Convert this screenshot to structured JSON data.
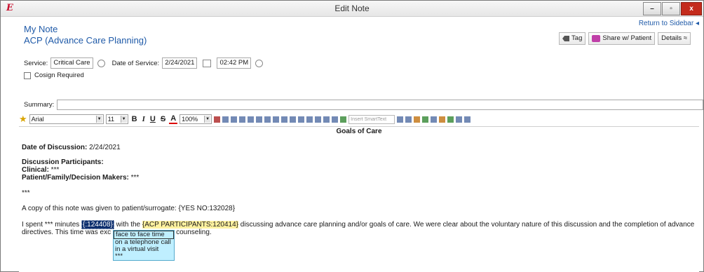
{
  "window": {
    "title": "Edit Note",
    "app_icon": "E",
    "btn_minimize": "–",
    "btn_maximize": "▫",
    "btn_close": "x"
  },
  "sidebar": {
    "return_label": "Return to Sidebar ◂"
  },
  "note": {
    "title": "My Note",
    "subtitle": "ACP (Advance Care Planning)"
  },
  "actions": {
    "tag_label": "Tag",
    "share_label": "Share w/ Patient",
    "details_label": "Details ≈"
  },
  "form": {
    "service_label": "Service:",
    "service_value": "Critical Care",
    "date_label": "Date of Service:",
    "date_value": "2/24/2021",
    "time_value": "02:42 PM",
    "cosign_label": "Cosign Required",
    "summary_label": "Summary:"
  },
  "toolbar": {
    "font": "Arial",
    "size": "11",
    "zoom": "100%",
    "smarttext_placeholder": "Insert SmartText"
  },
  "editor": {
    "section_title": "Goals of Care",
    "date_label": "Date of Discussion:",
    "date_value": " 2/24/2021",
    "participants_label": "Discussion Participants:",
    "clinical_label": "Clinical:",
    "clinical_value": " ***",
    "family_label": "Patient/Family/Decision Makers:",
    "family_value": " ***",
    "stars": "***",
    "copy_text": "A copy of this note was given to patient/surrogate:  {YES NO:132028}",
    "spent_prefix": "I spent *** minutes ",
    "spent_token": "{:124408}",
    "spent_mid": " with the ",
    "participants_token": "{ACP PARTICIPANTS:120414}",
    "spent_rest": " discussing advance care planning and/or goals of care.  We were clear about the voluntary nature of this discussion and the completion of advance",
    "directives_prefix": "directives.  This time was exc",
    "directives_suffix": "counseling."
  },
  "dropdown": {
    "items": [
      {
        "label": "face to face time"
      },
      {
        "label": "on a telephone call"
      },
      {
        "label": "in a virtual visit"
      },
      {
        "label": "***"
      }
    ]
  }
}
